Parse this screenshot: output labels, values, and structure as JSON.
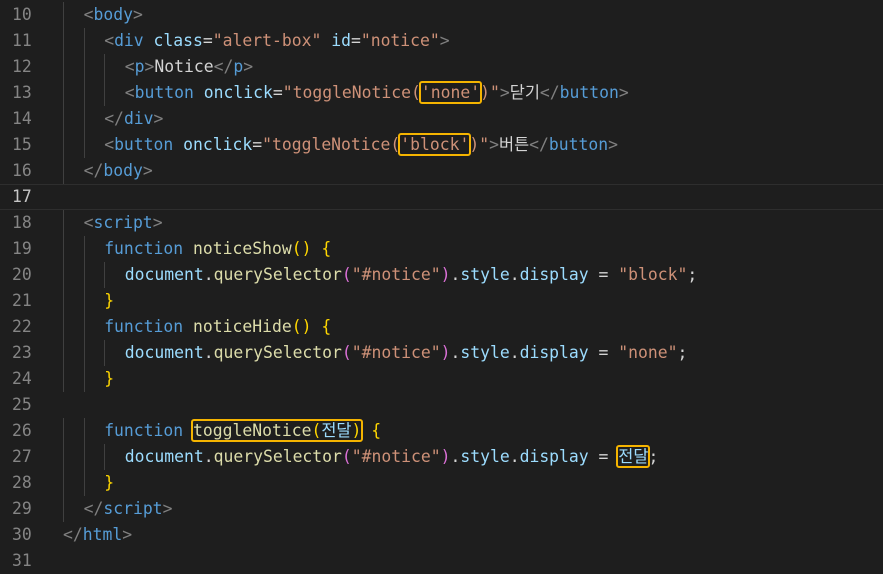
{
  "editor": {
    "lines": [
      {
        "n": "10",
        "indent": 1,
        "tokens": [
          [
            "t-br",
            "<"
          ],
          [
            "t-tag",
            "body"
          ],
          [
            "t-br",
            ">"
          ]
        ]
      },
      {
        "n": "11",
        "indent": 2,
        "tokens": [
          [
            "t-br",
            "<"
          ],
          [
            "t-tag",
            "div"
          ],
          [
            "t-txt",
            " "
          ],
          [
            "t-attr",
            "class"
          ],
          [
            "t-op",
            "="
          ],
          [
            "t-str",
            "\"alert-box\""
          ],
          [
            "t-txt",
            " "
          ],
          [
            "t-attr",
            "id"
          ],
          [
            "t-op",
            "="
          ],
          [
            "t-str",
            "\"notice\""
          ],
          [
            "t-br",
            ">"
          ]
        ]
      },
      {
        "n": "12",
        "indent": 3,
        "tokens": [
          [
            "t-br",
            "<"
          ],
          [
            "t-tag",
            "p"
          ],
          [
            "t-br",
            ">"
          ],
          [
            "t-txt",
            "Notice"
          ],
          [
            "t-br",
            "</"
          ],
          [
            "t-tag",
            "p"
          ],
          [
            "t-br",
            ">"
          ]
        ]
      },
      {
        "n": "13",
        "indent": 3,
        "tokens": [
          [
            "t-br",
            "<"
          ],
          [
            "t-tag",
            "button"
          ],
          [
            "t-txt",
            " "
          ],
          [
            "t-attr",
            "onclick"
          ],
          [
            "t-op",
            "="
          ],
          [
            "t-str",
            "\"toggleNotice"
          ],
          [
            "t-str",
            "("
          ],
          [
            "t-str",
            "'none'",
            "hl"
          ],
          [
            "t-str",
            ")\""
          ],
          [
            "t-br",
            ">"
          ],
          [
            "t-txt",
            "닫기"
          ],
          [
            "t-br",
            "</"
          ],
          [
            "t-tag",
            "button"
          ],
          [
            "t-br",
            ">"
          ]
        ]
      },
      {
        "n": "14",
        "indent": 2,
        "tokens": [
          [
            "t-br",
            "</"
          ],
          [
            "t-tag",
            "div"
          ],
          [
            "t-br",
            ">"
          ]
        ]
      },
      {
        "n": "15",
        "indent": 2,
        "tokens": [
          [
            "t-br",
            "<"
          ],
          [
            "t-tag",
            "button"
          ],
          [
            "t-txt",
            " "
          ],
          [
            "t-attr",
            "onclick"
          ],
          [
            "t-op",
            "="
          ],
          [
            "t-str",
            "\"toggleNotice"
          ],
          [
            "t-str",
            "("
          ],
          [
            "t-str",
            "'block'",
            "hl"
          ],
          [
            "t-str",
            ")\""
          ],
          [
            "t-br",
            ">"
          ],
          [
            "t-txt",
            "버튼"
          ],
          [
            "t-br",
            "</"
          ],
          [
            "t-tag",
            "button"
          ],
          [
            "t-br",
            ">"
          ]
        ]
      },
      {
        "n": "16",
        "indent": 1,
        "tokens": [
          [
            "t-br",
            "</"
          ],
          [
            "t-tag",
            "body"
          ],
          [
            "t-br",
            ">"
          ]
        ]
      },
      {
        "n": "17",
        "indent": 0,
        "active": true,
        "tokens": []
      },
      {
        "n": "18",
        "indent": 1,
        "tokens": [
          [
            "t-br",
            "<"
          ],
          [
            "t-tag",
            "script"
          ],
          [
            "t-br",
            ">"
          ]
        ]
      },
      {
        "n": "19",
        "indent": 2,
        "tokens": [
          [
            "t-kw",
            "function"
          ],
          [
            "t-txt",
            " "
          ],
          [
            "t-fn",
            "noticeShow"
          ],
          [
            "t-p1",
            "()"
          ],
          [
            "t-txt",
            " "
          ],
          [
            "t-p1",
            "{"
          ]
        ]
      },
      {
        "n": "20",
        "indent": 3,
        "tokens": [
          [
            "t-var",
            "document"
          ],
          [
            "t-txt",
            "."
          ],
          [
            "t-fn",
            "querySelector"
          ],
          [
            "t-p2",
            "("
          ],
          [
            "t-str",
            "\"#notice\""
          ],
          [
            "t-p2",
            ")"
          ],
          [
            "t-txt",
            "."
          ],
          [
            "t-var",
            "style"
          ],
          [
            "t-txt",
            "."
          ],
          [
            "t-var",
            "display"
          ],
          [
            "t-op",
            " = "
          ],
          [
            "t-str",
            "\"block\""
          ],
          [
            "t-txt",
            ";"
          ]
        ]
      },
      {
        "n": "21",
        "indent": 2,
        "tokens": [
          [
            "t-p1",
            "}"
          ]
        ]
      },
      {
        "n": "22",
        "indent": 2,
        "tokens": [
          [
            "t-kw",
            "function"
          ],
          [
            "t-txt",
            " "
          ],
          [
            "t-fn",
            "noticeHide"
          ],
          [
            "t-p1",
            "()"
          ],
          [
            "t-txt",
            " "
          ],
          [
            "t-p1",
            "{"
          ]
        ]
      },
      {
        "n": "23",
        "indent": 3,
        "tokens": [
          [
            "t-var",
            "document"
          ],
          [
            "t-txt",
            "."
          ],
          [
            "t-fn",
            "querySelector"
          ],
          [
            "t-p2",
            "("
          ],
          [
            "t-str",
            "\"#notice\""
          ],
          [
            "t-p2",
            ")"
          ],
          [
            "t-txt",
            "."
          ],
          [
            "t-var",
            "style"
          ],
          [
            "t-txt",
            "."
          ],
          [
            "t-var",
            "display"
          ],
          [
            "t-op",
            " = "
          ],
          [
            "t-str",
            "\"none\""
          ],
          [
            "t-txt",
            ";"
          ]
        ]
      },
      {
        "n": "24",
        "indent": 2,
        "tokens": [
          [
            "t-p1",
            "}"
          ]
        ]
      },
      {
        "n": "25",
        "indent": 0,
        "tokens": []
      },
      {
        "n": "26",
        "indent": 2,
        "tokens": [
          [
            "t-kw",
            "function"
          ],
          [
            "t-txt",
            " "
          ],
          [
            "t-fn",
            "toggleNotice",
            "hlstart"
          ],
          [
            "t-p1",
            "("
          ],
          [
            "t-var",
            "전달"
          ],
          [
            "t-p1",
            ")",
            "hlend"
          ],
          [
            "t-txt",
            " "
          ],
          [
            "t-p1",
            "{"
          ]
        ]
      },
      {
        "n": "27",
        "indent": 3,
        "tokens": [
          [
            "t-var",
            "document"
          ],
          [
            "t-txt",
            "."
          ],
          [
            "t-fn",
            "querySelector"
          ],
          [
            "t-p2",
            "("
          ],
          [
            "t-str",
            "\"#notice\""
          ],
          [
            "t-p2",
            ")"
          ],
          [
            "t-txt",
            "."
          ],
          [
            "t-var",
            "style"
          ],
          [
            "t-txt",
            "."
          ],
          [
            "t-var",
            "display"
          ],
          [
            "t-op",
            " = "
          ],
          [
            "t-var",
            "전달",
            "hl"
          ],
          [
            "t-txt",
            ";"
          ]
        ]
      },
      {
        "n": "28",
        "indent": 2,
        "tokens": [
          [
            "t-p1",
            "}"
          ]
        ]
      },
      {
        "n": "29",
        "indent": 1,
        "tokens": [
          [
            "t-br",
            "</"
          ],
          [
            "t-tag",
            "script"
          ],
          [
            "t-br",
            ">"
          ]
        ]
      },
      {
        "n": "30",
        "indent": 0,
        "tokens": [
          [
            "t-br",
            "</"
          ],
          [
            "t-tag",
            "html"
          ],
          [
            "t-br",
            ">"
          ]
        ]
      },
      {
        "n": "31",
        "indent": 0,
        "tokens": []
      }
    ]
  },
  "colors": {
    "background": "#1e1e1e",
    "highlight_box": "#f5b400"
  }
}
